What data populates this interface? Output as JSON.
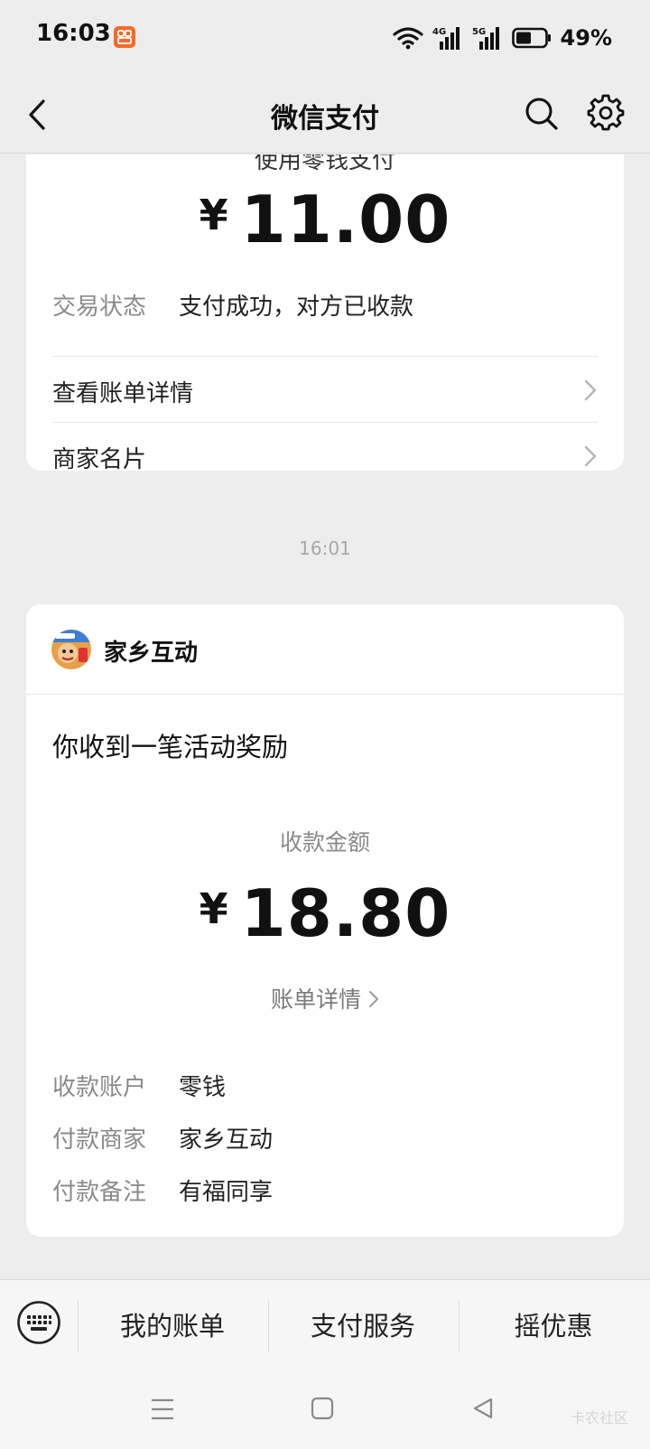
{
  "status_bar": {
    "time": "16:03",
    "battery": "49%",
    "icons": [
      "wifi-icon",
      "signal-4g-icon",
      "signal-5g-icon",
      "battery-icon"
    ]
  },
  "nav": {
    "title": "微信支付",
    "back_icon": "chevron-left-icon",
    "search_icon": "search-icon",
    "settings_icon": "gear-icon"
  },
  "payment_card": {
    "method": "使用零钱支付",
    "currency": "¥",
    "amount": "11.00",
    "status_label": "交易状态",
    "status_value": "支付成功，对方已收款",
    "links": [
      {
        "label": "查看账单详情"
      },
      {
        "label": "商家名片"
      }
    ]
  },
  "timestamp": "16:01",
  "reward_card": {
    "merchant": "家乡互动",
    "title": "你收到一笔活动奖励",
    "amount_label": "收款金额",
    "currency": "¥",
    "amount": "18.80",
    "bill_link": "账单详情",
    "details": [
      {
        "label": "收款账户",
        "value": "零钱"
      },
      {
        "label": "付款商家",
        "value": "家乡互动"
      },
      {
        "label": "付款备注",
        "value": "有福同享"
      }
    ]
  },
  "bottom_menu": {
    "items": [
      {
        "label": "我的账单"
      },
      {
        "label": "支付服务"
      },
      {
        "label": "摇优惠"
      }
    ]
  },
  "watermark": "卡农社区",
  "colors": {
    "background": "#ededed",
    "card": "#ffffff",
    "muted_text": "#8a8a8a"
  }
}
